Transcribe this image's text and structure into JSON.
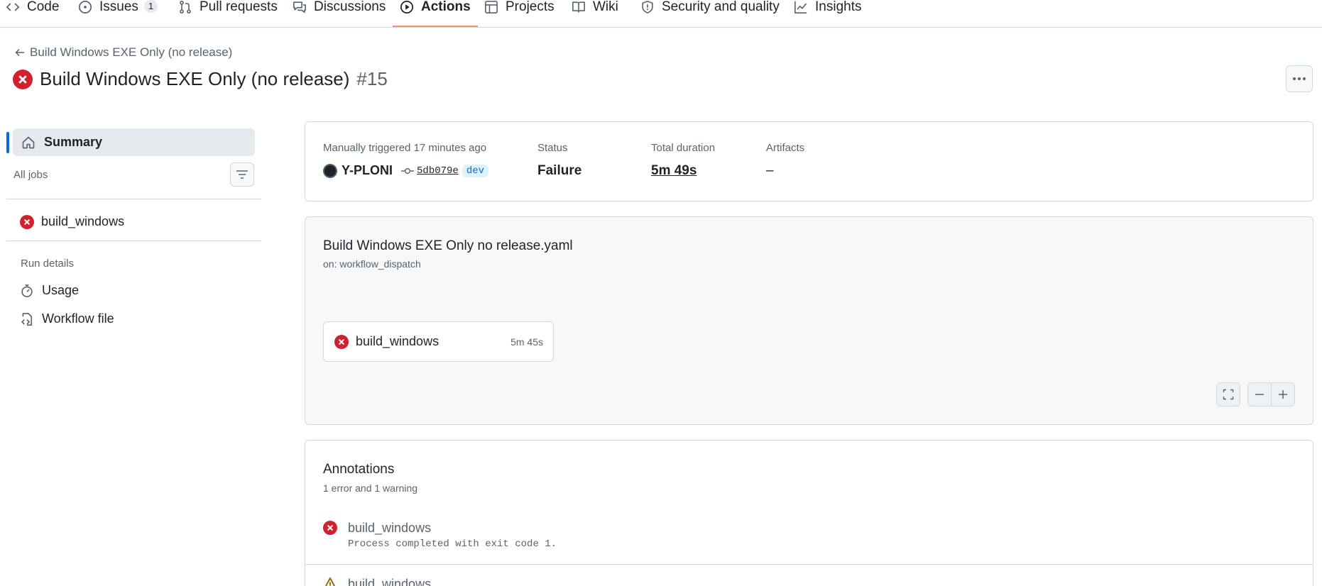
{
  "nav": {
    "tabs": [
      {
        "label": "Code",
        "icon": "code-icon"
      },
      {
        "label": "Issues",
        "icon": "issue-opened-icon",
        "count": "1"
      },
      {
        "label": "Pull requests",
        "icon": "git-pull-request-icon"
      },
      {
        "label": "Discussions",
        "icon": "comment-discussion-icon"
      },
      {
        "label": "Actions",
        "icon": "play-icon",
        "active": true
      },
      {
        "label": "Projects",
        "icon": "table-icon"
      },
      {
        "label": "Wiki",
        "icon": "book-icon"
      },
      {
        "label": "Security and quality",
        "icon": "shield-icon"
      },
      {
        "label": "Insights",
        "icon": "graph-icon"
      }
    ],
    "active_color": "#fd8c73"
  },
  "header": {
    "back_label": "Build Windows EXE Only (no release)",
    "title": "Build Windows EXE Only (no release)",
    "run_number": "#15",
    "status_icon": "x-circle-fill-icon"
  },
  "sidebar": {
    "summary_label": "Summary",
    "all_jobs_label": "All jobs",
    "jobs": [
      {
        "name": "build_windows",
        "status": "failure"
      }
    ],
    "run_details_label": "Run details",
    "links": [
      {
        "label": "Usage",
        "icon": "stopwatch-icon"
      },
      {
        "label": "Workflow file",
        "icon": "file-code-icon"
      }
    ]
  },
  "summary_card": {
    "trigger_label": "Manually triggered 17 minutes ago",
    "actor": "Y-PLONI",
    "commit_sha": "5db079e",
    "branch": "dev",
    "status_label": "Status",
    "status_value": "Failure",
    "duration_label": "Total duration",
    "duration_value": "5m 49s",
    "artifacts_label": "Artifacts",
    "artifacts_value": "–"
  },
  "workflow_card": {
    "file_name": "Build Windows EXE Only no release.yaml",
    "trigger": "on: workflow_dispatch",
    "job": {
      "name": "build_windows",
      "duration": "5m 45s"
    }
  },
  "annotations": {
    "title": "Annotations",
    "subtitle": "1 error and 1 warning",
    "items": [
      {
        "job": "build_windows",
        "message": "Process completed with exit code 1.",
        "level": "error"
      },
      {
        "job": "build_windows",
        "message": "",
        "level": "warning"
      }
    ]
  },
  "colors": {
    "error": "#cf222e",
    "accent_blue": "#0969da",
    "muted_text": "#59636e",
    "border": "#d1d9e0"
  }
}
